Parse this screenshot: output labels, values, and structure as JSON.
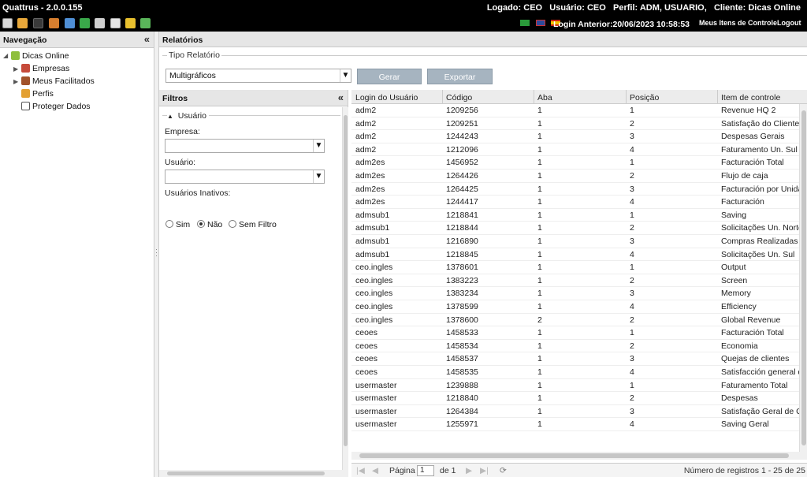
{
  "app": {
    "title": "Quattrus - 2.0.0.155"
  },
  "session": {
    "logado_label": "Logado:",
    "logado_value": "CEO",
    "usuario_label": "Usuário:",
    "usuario_value": "CEO",
    "perfil_label": "Perfil:",
    "perfil_value": "ADM, USUARIO,",
    "cliente_label": "Cliente:",
    "cliente_value": "Dicas Online",
    "login_anterior": "Login Anterior:20/06/2023 10:58:53"
  },
  "toolbar": {
    "icons": [
      "rocket-icon",
      "users-icon",
      "calendar-icon",
      "bar-chart-icon",
      "document-icon",
      "export-icon",
      "print-icon",
      "book-icon",
      "shield-icon",
      "refresh-icon"
    ],
    "flags": [
      "brazil-flag-icon",
      "uk-flag-icon",
      "spain-flag-icon"
    ],
    "menu_label": "Meus Itens de Controle",
    "logout_label": "Logout"
  },
  "nav": {
    "title": "Navegação",
    "root": "Dicas Online",
    "items": [
      "Empresas",
      "Meus Facilitados",
      "Perfis",
      "Proteger Dados"
    ]
  },
  "report": {
    "panel_title": "Relatórios",
    "tipo_label": "Tipo Relatório",
    "tipo_value": "Multigráficos",
    "gerar_label": "Gerar",
    "exportar_label": "Exportar"
  },
  "filters": {
    "title": "Filtros",
    "group_label": "Usuário",
    "empresa_label": "Empresa:",
    "empresa_value": "",
    "usuario_label": "Usuário:",
    "usuario_value": "",
    "inativos_label": "Usuários Inativos:",
    "options": [
      "Sim",
      "Não",
      "Sem Filtro"
    ],
    "selected": "Não"
  },
  "table": {
    "columns": [
      "Login do Usuário",
      "Código",
      "Aba",
      "Posição",
      "Item de controle"
    ],
    "rows": [
      [
        "adm2",
        "1209256",
        "1",
        "1",
        "Revenue HQ 2"
      ],
      [
        "adm2",
        "1209251",
        "1",
        "2",
        "Satisfação do Cliente"
      ],
      [
        "adm2",
        "1244243",
        "1",
        "3",
        "Despesas Gerais"
      ],
      [
        "adm2",
        "1212096",
        "1",
        "4",
        "Faturamento Un. Sul"
      ],
      [
        "adm2es",
        "1456952",
        "1",
        "1",
        "Facturación Total"
      ],
      [
        "adm2es",
        "1264426",
        "1",
        "2",
        "Flujo de caja"
      ],
      [
        "adm2es",
        "1264425",
        "1",
        "3",
        "Facturación por Unidad d"
      ],
      [
        "adm2es",
        "1244417",
        "1",
        "4",
        "Facturación"
      ],
      [
        "admsub1",
        "1218841",
        "1",
        "1",
        "Saving"
      ],
      [
        "admsub1",
        "1218844",
        "1",
        "2",
        "Solicitações Un. Norte"
      ],
      [
        "admsub1",
        "1216890",
        "1",
        "3",
        "Compras Realizadas"
      ],
      [
        "admsub1",
        "1218845",
        "1",
        "4",
        "Solicitações Un. Sul"
      ],
      [
        "ceo.ingles",
        "1378601",
        "1",
        "1",
        "Output"
      ],
      [
        "ceo.ingles",
        "1383223",
        "1",
        "2",
        "Screen"
      ],
      [
        "ceo.ingles",
        "1383234",
        "1",
        "3",
        "Memory"
      ],
      [
        "ceo.ingles",
        "1378599",
        "1",
        "4",
        "Efficiency"
      ],
      [
        "ceo.ingles",
        "1378600",
        "2",
        "2",
        "Global Revenue"
      ],
      [
        "ceoes",
        "1458533",
        "1",
        "1",
        "Facturación Total"
      ],
      [
        "ceoes",
        "1458534",
        "1",
        "2",
        "Economia"
      ],
      [
        "ceoes",
        "1458537",
        "1",
        "3",
        "Quejas de clientes"
      ],
      [
        "ceoes",
        "1458535",
        "1",
        "4",
        "Satisfacción general de cl"
      ],
      [
        "usermaster",
        "1239888",
        "1",
        "1",
        "Faturamento Total"
      ],
      [
        "usermaster",
        "1218840",
        "1",
        "2",
        "Despesas"
      ],
      [
        "usermaster",
        "1264384",
        "1",
        "3",
        "Satisfação Geral de Client"
      ],
      [
        "usermaster",
        "1255971",
        "1",
        "4",
        "Saving Geral"
      ]
    ]
  },
  "pager": {
    "page_label": "Página",
    "page_value": "1",
    "of_label": "de 1",
    "records_label": "Número de registros 1 - 25 de 25"
  }
}
